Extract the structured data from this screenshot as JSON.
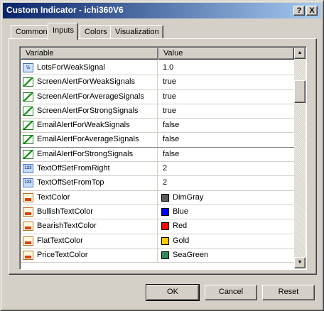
{
  "window": {
    "title": "Custom Indicator - ichi360V6",
    "help_btn": "?",
    "close_btn": "X"
  },
  "tabs": [
    {
      "label": "Common"
    },
    {
      "label": "Inputs",
      "active": true
    },
    {
      "label": "Colors"
    },
    {
      "label": "Visualization"
    }
  ],
  "table": {
    "columns": [
      "Variable",
      "Value"
    ],
    "rows": [
      {
        "icon": "half-icon",
        "variable": "LotsForWeakSignal",
        "value": "1.0"
      },
      {
        "icon": "alert-icon",
        "variable": "ScreenAlertForWeakSignals",
        "value": "true"
      },
      {
        "icon": "alert-icon",
        "variable": "ScreenAlertForAverageSignals",
        "value": "true"
      },
      {
        "icon": "alert-icon",
        "variable": "ScreenAlertForStrongSignals",
        "value": "true"
      },
      {
        "icon": "alert-icon",
        "variable": "EmailAlertForWeakSignals",
        "value": "false"
      },
      {
        "icon": "alert-icon",
        "variable": "EmailAlertForAverageSignals",
        "value": "false"
      },
      {
        "icon": "alert-icon",
        "variable": "EmailAlertForStrongSignals",
        "value": "false"
      },
      {
        "icon": "number-icon",
        "variable": "TextOffSetFromRight",
        "value": "2"
      },
      {
        "icon": "number-icon",
        "variable": "TextOffSetFromTop",
        "value": "2"
      },
      {
        "icon": "color-icon",
        "variable": "TextColor",
        "value": "DimGray",
        "swatch": "#5a5a5a"
      },
      {
        "icon": "color-icon",
        "variable": "BullishTextColor",
        "value": "Blue",
        "swatch": "#0000ff"
      },
      {
        "icon": "color-icon",
        "variable": "BearishTextColor",
        "value": "Red",
        "swatch": "#ff0000"
      },
      {
        "icon": "color-icon",
        "variable": "FlatTextColor",
        "value": "Gold",
        "swatch": "#ffcc00"
      },
      {
        "icon": "color-icon",
        "variable": "PriceTextColor",
        "value": "SeaGreen",
        "swatch": "#2e8b57"
      }
    ]
  },
  "scroll": {
    "up": "▲",
    "down": "▼"
  },
  "buttons": {
    "ok": "OK",
    "cancel": "Cancel",
    "reset": "Reset"
  },
  "icon_glyphs": {
    "half": "½",
    "number": "123"
  }
}
